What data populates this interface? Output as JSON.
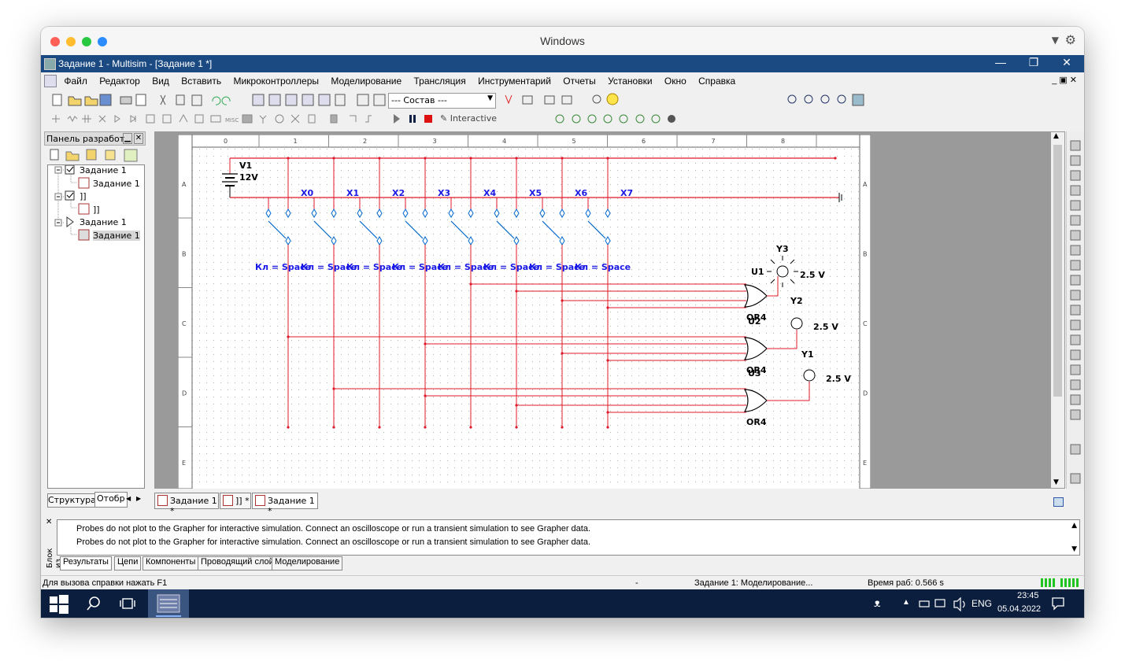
{
  "mac": {
    "title": "Windows"
  },
  "window": {
    "title": "Задание 1 - Multisim - [Задание 1 *]",
    "min": "—",
    "restore": "❐",
    "close": "✕"
  },
  "menu": [
    "Файл",
    "Редактор",
    "Вид",
    "Вставить",
    "Микроконтроллеры",
    "Моделирование",
    "Трансляция",
    "Инструментарий",
    "Отчеты",
    "Установки",
    "Окно",
    "Справка"
  ],
  "toolbar": {
    "combo_value": "--- Состав ---",
    "interactive_label": "Interactive"
  },
  "panel": {
    "title": "Панель разработки",
    "tree": [
      "Задание 1",
      "Задание 1",
      "]]",
      "]]",
      "Задание 1",
      "Задание 1"
    ],
    "tab_structure": "Структура",
    "tab_display": "Отобр"
  },
  "schematic": {
    "ruler_top": [
      "0",
      "1",
      "2",
      "3",
      "4",
      "5",
      "6",
      "7",
      "8"
    ],
    "ruler_left": [
      "A",
      "B",
      "C",
      "D",
      "E"
    ],
    "battery_name": "V1",
    "battery_voltage": "12V",
    "switch_labels": [
      "X0",
      "X1",
      "X2",
      "X3",
      "X4",
      "X5",
      "X6",
      "X7"
    ],
    "key_labels": [
      "Кл = Space",
      "Кл = Space",
      "Кл = Space",
      "Кл = Space",
      "Кл = Space",
      "Кл = Space",
      "Кл = Space",
      "Кл = Space"
    ],
    "gates": [
      {
        "ref": "U1",
        "type": "OR4",
        "out": "Y2"
      },
      {
        "ref": "U2",
        "type": "OR4",
        "out": "Y1"
      },
      {
        "ref": "U3",
        "type": "OR4",
        "out": ""
      }
    ],
    "probes": [
      {
        "name": "Y3",
        "voltage": "2.5 V",
        "lit": true
      },
      {
        "name": "",
        "voltage": "2.5 V",
        "lit": false
      },
      {
        "name": "",
        "voltage": "2.5 V",
        "lit": false
      }
    ]
  },
  "doc_tabs": [
    "Задание 1 *",
    "]] *",
    "Задание 1 *"
  ],
  "output": {
    "side_label": "Блок из",
    "lines": [
      "Probes do not plot to the Grapher for interactive simulation. Connect an oscilloscope or run a transient simulation to see Grapher data.",
      "Probes do not plot to the Grapher for interactive simulation. Connect an oscilloscope or run a transient simulation to see Grapher data."
    ],
    "tabs": [
      "Результаты",
      "Цепи",
      "Компоненты",
      "Проводящий слой",
      "Моделирование"
    ]
  },
  "status": {
    "help": "Для вызова справки нажать F1",
    "dash": "-",
    "sim": "Задание 1: Моделирование...",
    "time": "Время раб: 0.566 s"
  },
  "taskbar": {
    "lang": "ENG",
    "time": "23:45",
    "date": "05.04.2022"
  },
  "colors": {
    "wire": "#e0182a",
    "label_blue": "#1a1ae6",
    "titlebar": "#1b4a82",
    "taskbar": "#0c1e3d"
  }
}
